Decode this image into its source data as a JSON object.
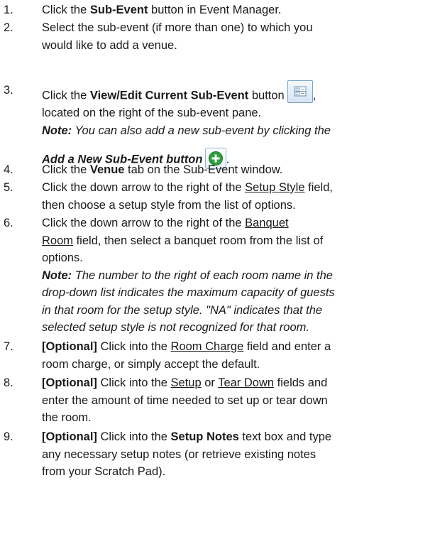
{
  "steps": [
    {
      "num": "1.",
      "pre": "Click the ",
      "bold": "Sub-Event",
      "post": " button in Event Manager."
    },
    {
      "num": "2.",
      "line1": "Select the sub-event (if more than one) to which you",
      "line2": "would like to add a venue."
    },
    {
      "num": "3.",
      "pre": "Click the ",
      "bold": "View/Edit Current Sub-Event",
      "post": " button",
      "comma": ",",
      "line2": "located on the right of the sub-event pane.",
      "note_label": "Note:",
      "note_text": " You can also add a new sub-event by clicking the",
      "note_line2_bold": "Add a New Sub-Event",
      "note_line2_rest": " button",
      "note_end": "."
    },
    {
      "num": "4.",
      "pre": "Click the ",
      "bold": "Venue",
      "post": " tab on the Sub-Event window."
    },
    {
      "num": "5.",
      "pre": "Click the down arrow to the right of the ",
      "field": "Setup Style",
      "post": " field,",
      "line2": "then choose a setup style from the list of options."
    },
    {
      "num": "6.",
      "pre": "Click the down arrow to the right of the ",
      "field": "Banquet",
      "field2": "Room",
      "post": " field, then select a banquet room from the list of",
      "line3": "options.",
      "note_label": "Note:",
      "note_l1": " The number to the right of each room name in the",
      "note_l2": "drop-down list indicates the maximum capacity of guests",
      "note_l3": "in that room for the setup style. \"NA\" indicates that the",
      "note_l4": "selected setup style is not recognized for that room."
    },
    {
      "num": "7.",
      "opt": "[Optional]",
      "pre": " Click into the ",
      "field": "Room Charge",
      "post": " field and enter a",
      "line2": "room charge, or simply accept the default."
    },
    {
      "num": "8.",
      "opt": "[Optional]",
      "pre": " Click into the ",
      "field": "Setup",
      "mid": " or ",
      "field2": "Tear Down",
      "post": " fields and",
      "line2": "enter the amount of time needed to set up or tear down",
      "line3": "the room."
    },
    {
      "num": "9.",
      "opt": "[Optional]",
      "pre": " Click into the ",
      "bold": "Setup Notes",
      "post": " text box and type",
      "line2": "any necessary setup notes (or retrieve existing notes",
      "line3": "from your Scratch Pad)."
    }
  ],
  "icons": {
    "view_edit": "view-edit-sub-event-icon",
    "add": "add-sub-event-icon",
    "accent": "#2e9e3e",
    "frame": "#7aa3c8"
  }
}
